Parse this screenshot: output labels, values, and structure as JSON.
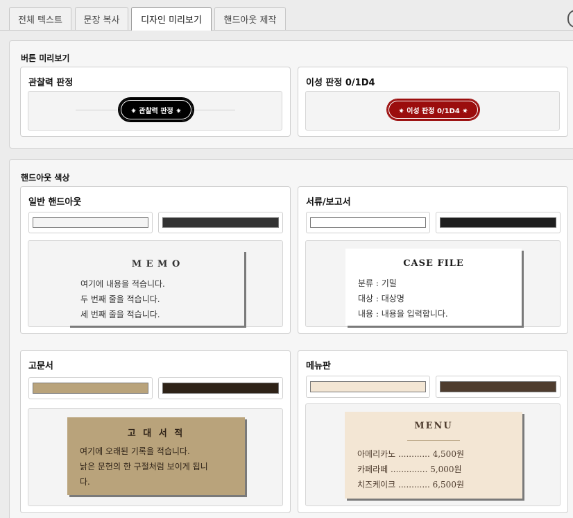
{
  "tabs": [
    {
      "label": "전체 텍스트"
    },
    {
      "label": "문장 복사"
    },
    {
      "label": "디자인 미리보기"
    },
    {
      "label": "핸드아웃 제작"
    }
  ],
  "button_section": {
    "title": "버튼 미리보기",
    "buttons": [
      {
        "box_title": "관찰력 판정",
        "label": "✷ 관찰력 판정 ✷",
        "bg": "#000000"
      },
      {
        "box_title": "이성 판정 0/1D4",
        "label": "✷ 이성 판정 0/1D4 ✷",
        "bg": "#9b0d0d"
      }
    ]
  },
  "handout_section": {
    "title": "핸드아웃 색상",
    "cards": [
      {
        "box_title": "일반 핸드아웃",
        "bg_color": "#f4f4f4",
        "text_color": "#333333",
        "paper_title": "M E M O",
        "lines": [
          "여기에 내용을 적습니다.",
          "두 번째 줄을 적습니다.",
          "세 번째 줄을 적습니다."
        ]
      },
      {
        "box_title": "서류/보고서",
        "bg_color": "#ffffff",
        "text_color": "#1e1e1e",
        "paper_title": "CASE FILE",
        "lines": [
          "분류 : 기밀",
          "대상 : 대상명",
          "내용 : 내용을 입력합니다."
        ]
      },
      {
        "box_title": "고문서",
        "bg_color": "#b9a37b",
        "text_color": "#2e2217",
        "paper_title": "고 대 서 적",
        "lines": [
          "여기에 오래된 기록을 적습니다.",
          "낡은 문헌의 한 구절처럼 보이게 됩니",
          "다."
        ]
      },
      {
        "box_title": "메뉴판",
        "bg_color": "#f3e6d4",
        "text_color": "#4e3c2e",
        "paper_title": "MENU",
        "lines": [
          "아메리카노 ............ 4,500원",
          "카페라떼 .............. 5,000원",
          "치즈케이크 ............ 6,500원"
        ]
      }
    ]
  }
}
